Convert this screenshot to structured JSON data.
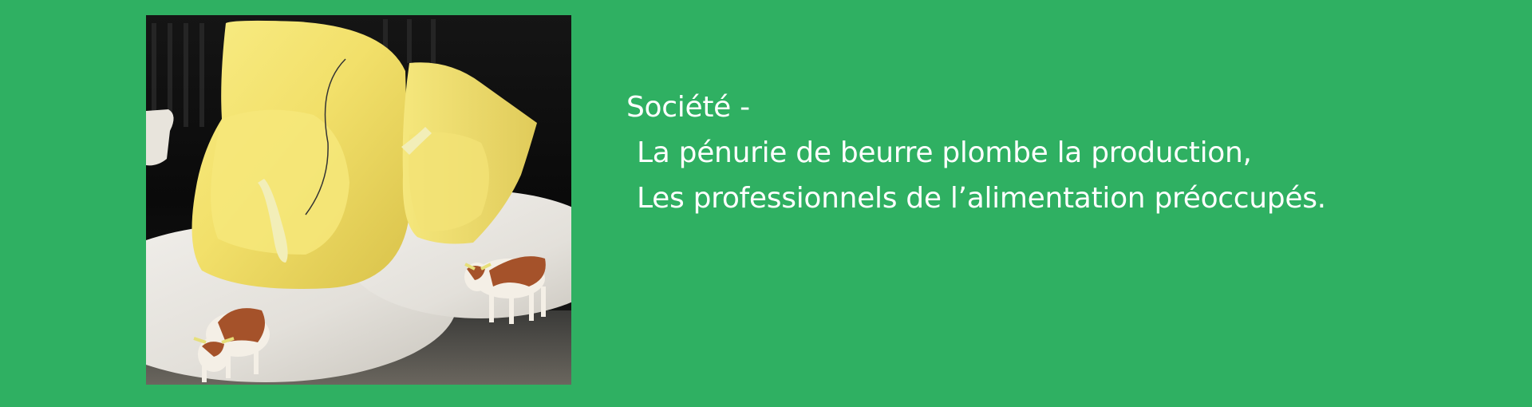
{
  "colors": {
    "background": "#2fb062",
    "text": "#ffffff"
  },
  "photo": {
    "subject": "butter-and-cow-figurines"
  },
  "headline": {
    "category": "Société -",
    "line1": "La pénurie de beurre plombe la production,",
    "line2": "Les professionnels de l’alimentation préoccupés."
  }
}
